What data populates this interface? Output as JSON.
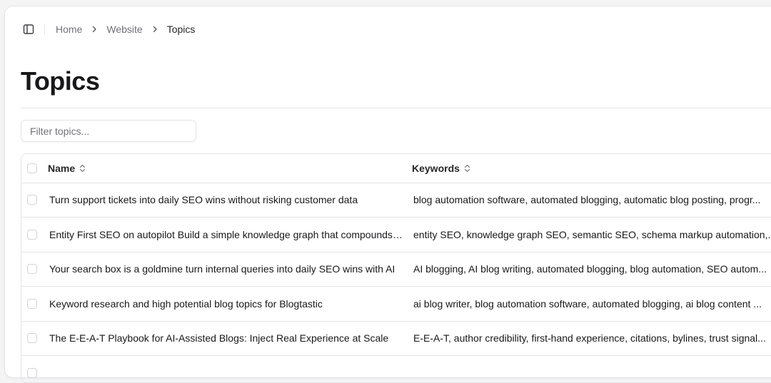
{
  "breadcrumb": {
    "items": [
      {
        "label": "Home"
      },
      {
        "label": "Website"
      },
      {
        "label": "Topics"
      }
    ]
  },
  "page": {
    "title": "Topics"
  },
  "filter": {
    "placeholder": "Filter topics...",
    "value": ""
  },
  "table": {
    "columns": [
      {
        "label": "Name",
        "sortable": true
      },
      {
        "label": "Keywords",
        "sortable": true
      }
    ],
    "rows": [
      {
        "name": "Turn support tickets into daily SEO wins without risking customer data",
        "keywords": "blog automation software, automated blogging, automatic blog posting, progr..."
      },
      {
        "name": "Entity First SEO on autopilot Build a simple knowledge graph that compounds r...",
        "keywords": "entity SEO, knowledge graph SEO, semantic SEO, schema markup automation,..."
      },
      {
        "name": "Your search box is a goldmine turn internal queries into daily SEO wins with AI",
        "keywords": "AI blogging, AI blog writing, automated blogging, blog automation, SEO autom..."
      },
      {
        "name": "Keyword research and high potential blog topics for Blogtastic",
        "keywords": "ai blog writer, blog automation software, automated blogging, ai blog content ..."
      },
      {
        "name": "The E-E-A-T Playbook for AI-Assisted Blogs: Inject Real Experience at Scale",
        "keywords": "E-E-A-T, author credibility, first-hand experience, citations, bylines, trust signal..."
      },
      {
        "name": "",
        "keywords": ""
      }
    ]
  },
  "icons": {
    "sidebar_toggle": "sidebar-toggle-icon",
    "breadcrumb_separator": "chevron-right-icon",
    "sort": "sort-chevrons-icon"
  },
  "colors": {
    "background": "#f4f4f5",
    "panel": "#ffffff",
    "border": "#e4e4e7",
    "muted_text": "#71717a",
    "text": "#18181b"
  }
}
